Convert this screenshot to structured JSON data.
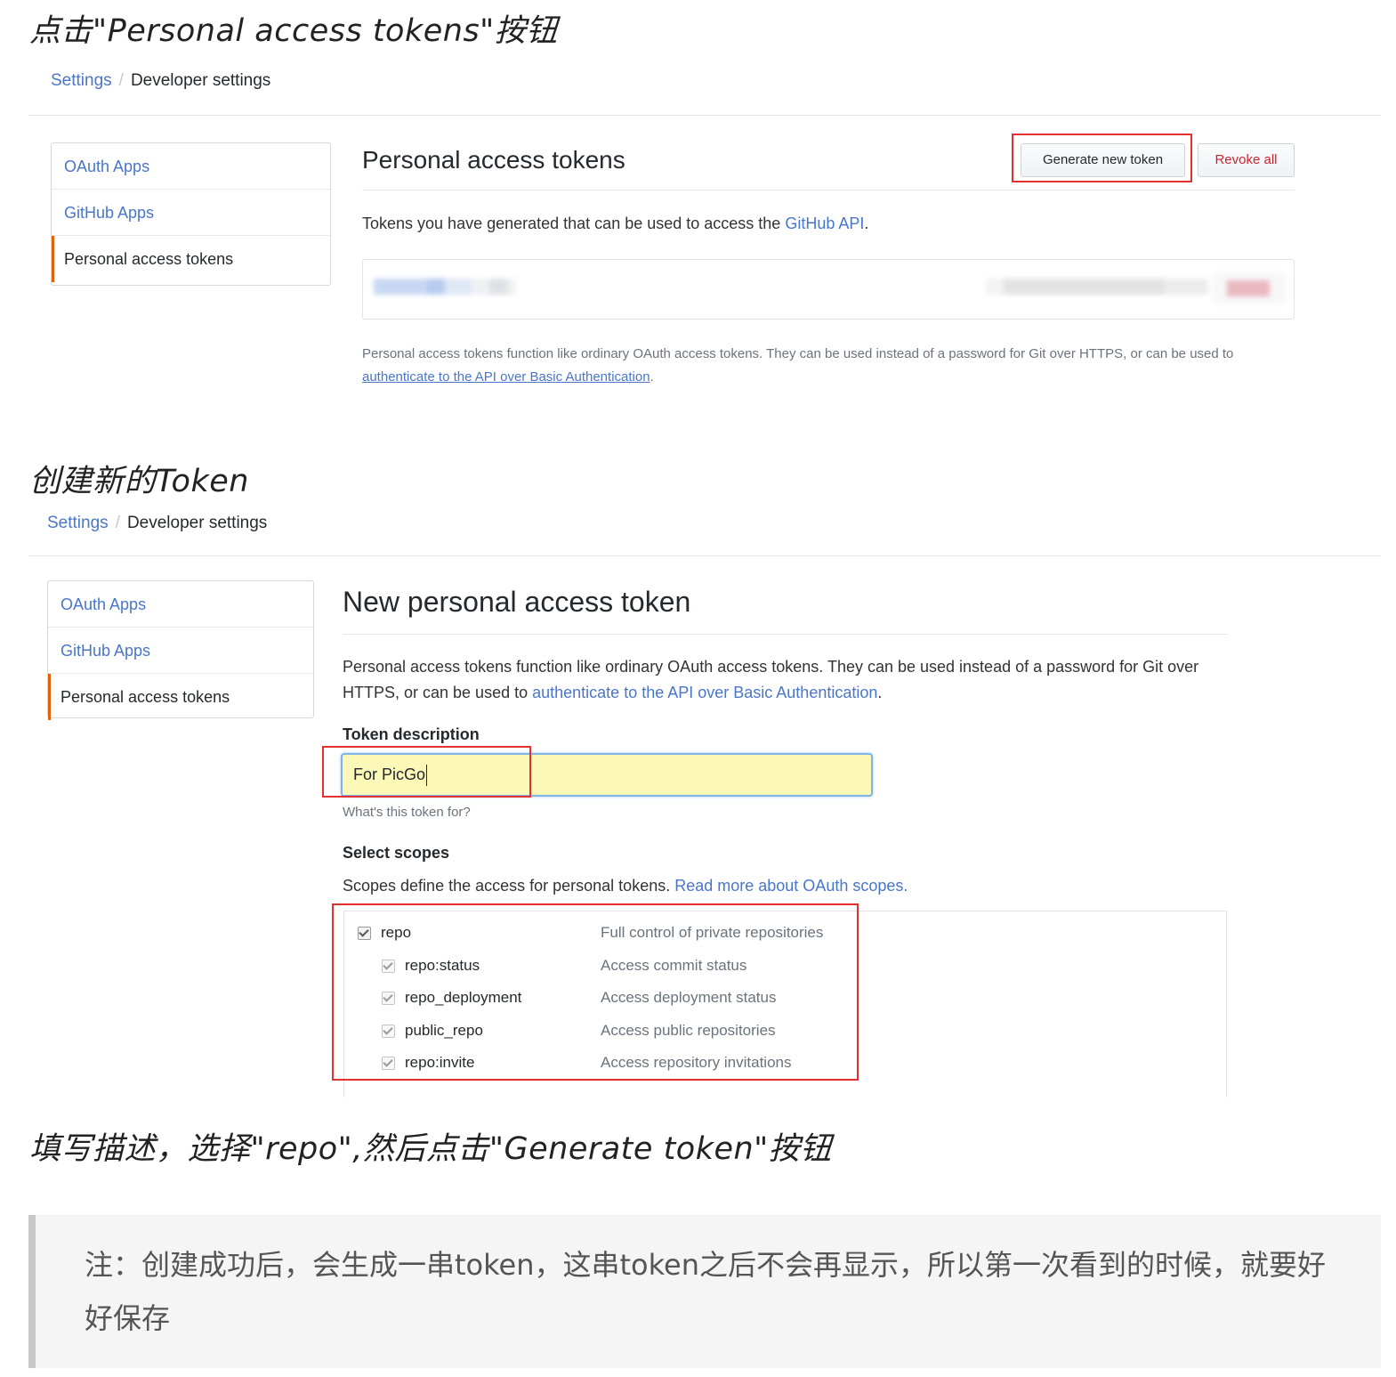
{
  "section1": {
    "heading": "点击\"Personal access tokens\"按钮",
    "breadcrumb": {
      "settings": "Settings",
      "separator": "/",
      "current": "Developer settings"
    },
    "sidebar": [
      "OAuth Apps",
      "GitHub Apps",
      "Personal access tokens"
    ],
    "title": "Personal access tokens",
    "generate_button": "Generate new token",
    "revoke_button": "Revoke all",
    "intro_prefix": "Tokens you have generated that can be used to access the ",
    "intro_link": "GitHub API",
    "intro_suffix": ".",
    "footnote_prefix": "Personal access tokens function like ordinary OAuth access tokens. They can be used instead of a password for Git over HTTPS, or can be used to ",
    "footnote_link": "authenticate to the API over Basic Authentication",
    "footnote_suffix": "."
  },
  "section2": {
    "heading": "创建新的Token",
    "breadcrumb": {
      "settings": "Settings",
      "separator": "/",
      "current": "Developer settings"
    },
    "sidebar": [
      "OAuth Apps",
      "GitHub Apps",
      "Personal access tokens"
    ],
    "title": "New personal access token",
    "desc_prefix": "Personal access tokens function like ordinary OAuth access tokens. They can be used instead of a password for Git over HTTPS, or can be used to ",
    "desc_link": "authenticate to the API over Basic Authentication",
    "desc_suffix": ".",
    "token_label": "Token description",
    "token_value": "For PicGo",
    "token_hint": "What's this token for?",
    "scopes_label": "Select scopes",
    "scopes_prefix": "Scopes define the access for personal tokens. ",
    "scopes_link": "Read more about OAuth scopes.",
    "scopes": [
      {
        "name": "repo",
        "desc": "Full control of private repositories",
        "checked": true
      },
      {
        "name": "repo:status",
        "desc": "Access commit status",
        "checked": true
      },
      {
        "name": "repo_deployment",
        "desc": "Access deployment status",
        "checked": true
      },
      {
        "name": "public_repo",
        "desc": "Access public repositories",
        "checked": true
      },
      {
        "name": "repo:invite",
        "desc": "Access repository invitations",
        "checked": true
      }
    ]
  },
  "section3": {
    "heading": "填写描述，选择\"repo\",然后点击\"Generate token\"按钮"
  },
  "note": {
    "text": "注：创建成功后，会生成一串token，这串token之后不会再显示，所以第一次看到的时候，就要好好保存"
  }
}
